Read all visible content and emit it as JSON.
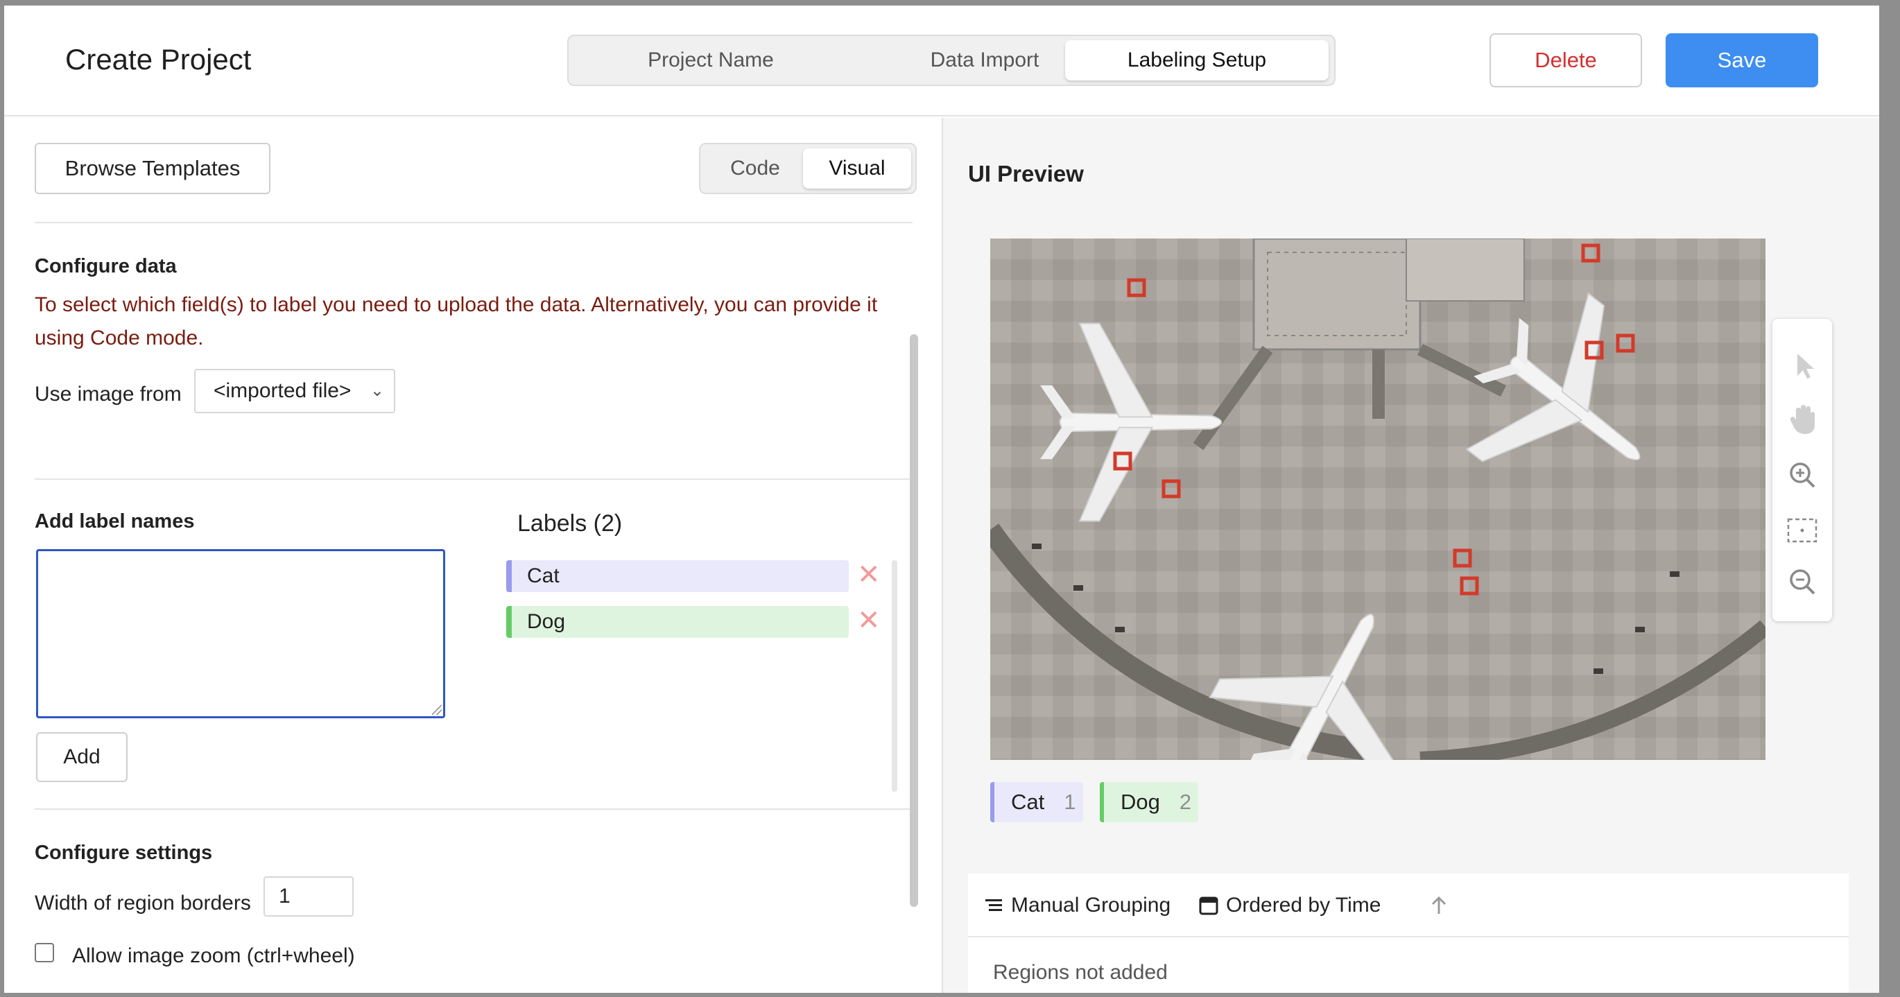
{
  "header": {
    "title": "Create Project",
    "steps": [
      "Project Name",
      "Data Import",
      "Labeling Setup"
    ],
    "active_step": "Labeling Setup",
    "delete_label": "Delete",
    "save_label": "Save"
  },
  "left": {
    "browse_label": "Browse Templates",
    "modes": [
      "Code",
      "Visual"
    ],
    "active_mode": "Visual",
    "configure_data": {
      "title": "Configure data",
      "warning": "To select which field(s) to label you need to upload the data. Alternatively, you can provide it using Code mode.",
      "use_image_label": "Use image from",
      "use_image_value": "<imported file>"
    },
    "labels": {
      "add_title": "Add label names",
      "add_button": "Add",
      "list_title": "Labels (2)",
      "items": [
        {
          "name": "Cat",
          "bg": "#e9e9fb",
          "bar": "#9a9aee"
        },
        {
          "name": "Dog",
          "bg": "#dff4df",
          "bar": "#66cc66"
        }
      ]
    },
    "settings": {
      "title": "Configure settings",
      "width_label": "Width of region borders",
      "width_value": "1",
      "zoom_label": "Allow image zoom (ctrl+wheel)"
    }
  },
  "right": {
    "preview_title": "UI Preview",
    "tools": [
      "pointer-icon",
      "hand-icon",
      "zoom-in-icon",
      "fit-icon",
      "zoom-out-icon"
    ],
    "chips": [
      {
        "name": "Cat",
        "hotkey": "1",
        "bg": "#e9e9fb",
        "bar": "#9a9aee"
      },
      {
        "name": "Dog",
        "hotkey": "2",
        "bg": "#dff4df",
        "bar": "#66cc66"
      }
    ],
    "grouping_label": "Manual Grouping",
    "ordering_label": "Ordered by Time",
    "regions_empty": "Regions not added"
  },
  "colors": {
    "accent": "#3d8ef0",
    "danger": "#d3302f",
    "warning_text": "#7a1c0f"
  }
}
